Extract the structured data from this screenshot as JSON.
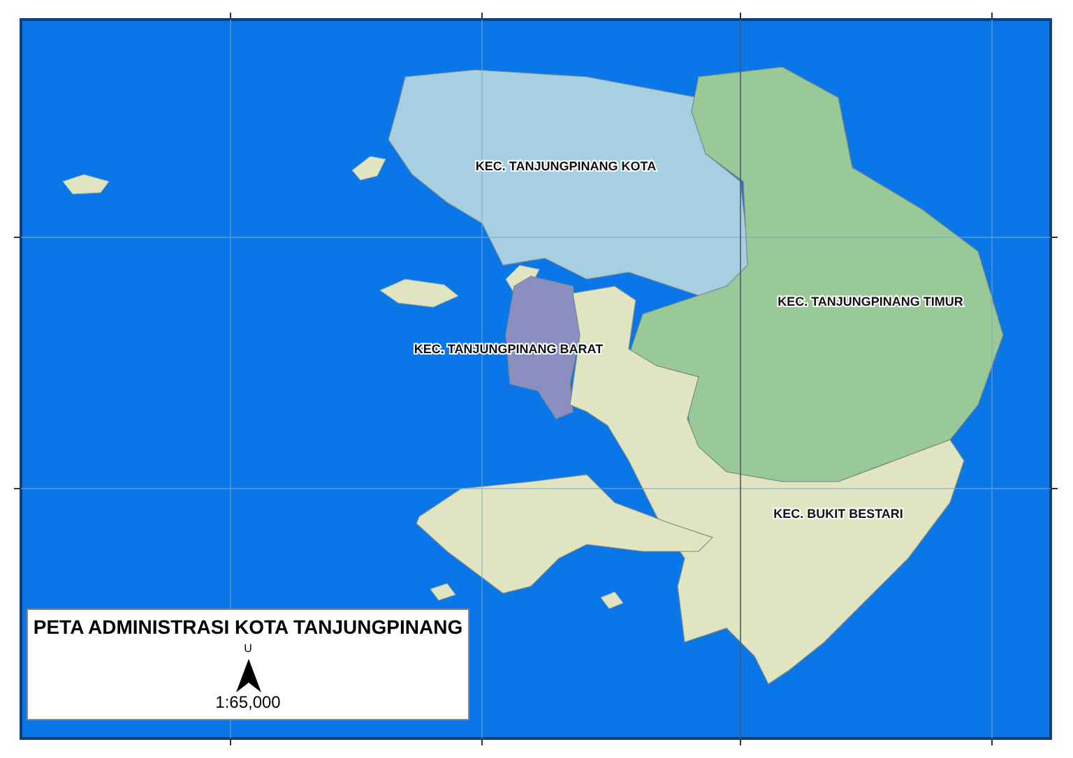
{
  "map": {
    "districts": [
      {
        "name": "KEC. TANJUNGPINANG KOTA",
        "color": "#a6cfe2"
      },
      {
        "name": "KEC. TANJUNGPINANG TIMUR",
        "color": "#98c996"
      },
      {
        "name": "KEC. TANJUNGPINANG BARAT",
        "color": "#8a8ec0"
      },
      {
        "name": "KEC. BUKIT BESTARI",
        "color": "#e0e4c0"
      }
    ]
  },
  "legend": {
    "title": "PETA ADMINISTRASI KOTA TANJUNGPINANG",
    "north_label": "U",
    "scale": "1:65,000"
  }
}
